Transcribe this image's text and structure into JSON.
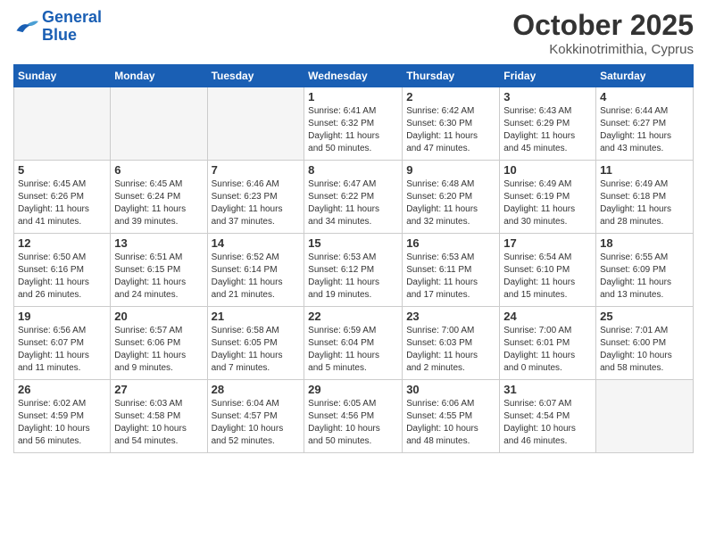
{
  "logo": {
    "line1": "General",
    "line2": "Blue"
  },
  "title": "October 2025",
  "location": "Kokkinotrimithia, Cyprus",
  "weekdays": [
    "Sunday",
    "Monday",
    "Tuesday",
    "Wednesday",
    "Thursday",
    "Friday",
    "Saturday"
  ],
  "weeks": [
    [
      {
        "day": "",
        "info": ""
      },
      {
        "day": "",
        "info": ""
      },
      {
        "day": "",
        "info": ""
      },
      {
        "day": "1",
        "info": "Sunrise: 6:41 AM\nSunset: 6:32 PM\nDaylight: 11 hours\nand 50 minutes."
      },
      {
        "day": "2",
        "info": "Sunrise: 6:42 AM\nSunset: 6:30 PM\nDaylight: 11 hours\nand 47 minutes."
      },
      {
        "day": "3",
        "info": "Sunrise: 6:43 AM\nSunset: 6:29 PM\nDaylight: 11 hours\nand 45 minutes."
      },
      {
        "day": "4",
        "info": "Sunrise: 6:44 AM\nSunset: 6:27 PM\nDaylight: 11 hours\nand 43 minutes."
      }
    ],
    [
      {
        "day": "5",
        "info": "Sunrise: 6:45 AM\nSunset: 6:26 PM\nDaylight: 11 hours\nand 41 minutes."
      },
      {
        "day": "6",
        "info": "Sunrise: 6:45 AM\nSunset: 6:24 PM\nDaylight: 11 hours\nand 39 minutes."
      },
      {
        "day": "7",
        "info": "Sunrise: 6:46 AM\nSunset: 6:23 PM\nDaylight: 11 hours\nand 37 minutes."
      },
      {
        "day": "8",
        "info": "Sunrise: 6:47 AM\nSunset: 6:22 PM\nDaylight: 11 hours\nand 34 minutes."
      },
      {
        "day": "9",
        "info": "Sunrise: 6:48 AM\nSunset: 6:20 PM\nDaylight: 11 hours\nand 32 minutes."
      },
      {
        "day": "10",
        "info": "Sunrise: 6:49 AM\nSunset: 6:19 PM\nDaylight: 11 hours\nand 30 minutes."
      },
      {
        "day": "11",
        "info": "Sunrise: 6:49 AM\nSunset: 6:18 PM\nDaylight: 11 hours\nand 28 minutes."
      }
    ],
    [
      {
        "day": "12",
        "info": "Sunrise: 6:50 AM\nSunset: 6:16 PM\nDaylight: 11 hours\nand 26 minutes."
      },
      {
        "day": "13",
        "info": "Sunrise: 6:51 AM\nSunset: 6:15 PM\nDaylight: 11 hours\nand 24 minutes."
      },
      {
        "day": "14",
        "info": "Sunrise: 6:52 AM\nSunset: 6:14 PM\nDaylight: 11 hours\nand 21 minutes."
      },
      {
        "day": "15",
        "info": "Sunrise: 6:53 AM\nSunset: 6:12 PM\nDaylight: 11 hours\nand 19 minutes."
      },
      {
        "day": "16",
        "info": "Sunrise: 6:53 AM\nSunset: 6:11 PM\nDaylight: 11 hours\nand 17 minutes."
      },
      {
        "day": "17",
        "info": "Sunrise: 6:54 AM\nSunset: 6:10 PM\nDaylight: 11 hours\nand 15 minutes."
      },
      {
        "day": "18",
        "info": "Sunrise: 6:55 AM\nSunset: 6:09 PM\nDaylight: 11 hours\nand 13 minutes."
      }
    ],
    [
      {
        "day": "19",
        "info": "Sunrise: 6:56 AM\nSunset: 6:07 PM\nDaylight: 11 hours\nand 11 minutes."
      },
      {
        "day": "20",
        "info": "Sunrise: 6:57 AM\nSunset: 6:06 PM\nDaylight: 11 hours\nand 9 minutes."
      },
      {
        "day": "21",
        "info": "Sunrise: 6:58 AM\nSunset: 6:05 PM\nDaylight: 11 hours\nand 7 minutes."
      },
      {
        "day": "22",
        "info": "Sunrise: 6:59 AM\nSunset: 6:04 PM\nDaylight: 11 hours\nand 5 minutes."
      },
      {
        "day": "23",
        "info": "Sunrise: 7:00 AM\nSunset: 6:03 PM\nDaylight: 11 hours\nand 2 minutes."
      },
      {
        "day": "24",
        "info": "Sunrise: 7:00 AM\nSunset: 6:01 PM\nDaylight: 11 hours\nand 0 minutes."
      },
      {
        "day": "25",
        "info": "Sunrise: 7:01 AM\nSunset: 6:00 PM\nDaylight: 10 hours\nand 58 minutes."
      }
    ],
    [
      {
        "day": "26",
        "info": "Sunrise: 6:02 AM\nSunset: 4:59 PM\nDaylight: 10 hours\nand 56 minutes."
      },
      {
        "day": "27",
        "info": "Sunrise: 6:03 AM\nSunset: 4:58 PM\nDaylight: 10 hours\nand 54 minutes."
      },
      {
        "day": "28",
        "info": "Sunrise: 6:04 AM\nSunset: 4:57 PM\nDaylight: 10 hours\nand 52 minutes."
      },
      {
        "day": "29",
        "info": "Sunrise: 6:05 AM\nSunset: 4:56 PM\nDaylight: 10 hours\nand 50 minutes."
      },
      {
        "day": "30",
        "info": "Sunrise: 6:06 AM\nSunset: 4:55 PM\nDaylight: 10 hours\nand 48 minutes."
      },
      {
        "day": "31",
        "info": "Sunrise: 6:07 AM\nSunset: 4:54 PM\nDaylight: 10 hours\nand 46 minutes."
      },
      {
        "day": "",
        "info": ""
      }
    ]
  ]
}
